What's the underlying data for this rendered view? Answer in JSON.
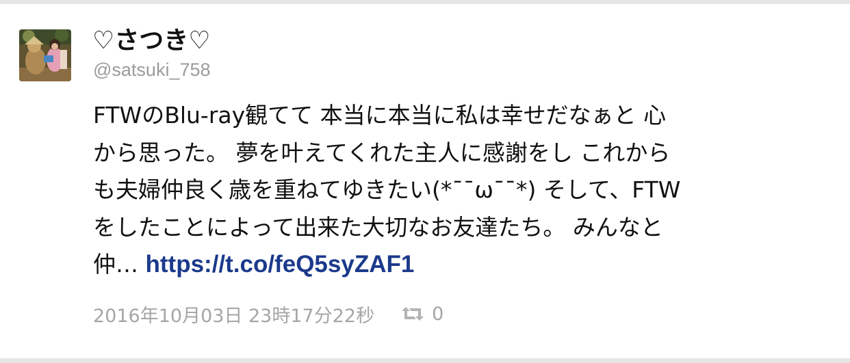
{
  "tweet": {
    "display_name": "♡さつき♡",
    "handle": "@satsuki_758",
    "text_lines": [
      "FTWのBlu-ray観てて 本当に本当に私は幸せだなぁと 心",
      "から思った。 夢を叶えてくれた主人に感謝をし これから",
      "も夫婦仲良く歳を重ねてゆきたい(*¯¯ω¯¯*) そして、FTW",
      "をしたことによって出来た大切なお友達たち。 みんなと"
    ],
    "last_line_prefix": "仲… ",
    "link": "https://t.co/feQ5syZAF1",
    "timestamp": "2016年10月03日 23時17分22秒",
    "retweet_count": "0"
  },
  "icons": {
    "avatar": "user-avatar-photo",
    "retweet": "retweet-icon"
  },
  "colors": {
    "link": "#1b3a8c",
    "meta_text": "#a5a5a5",
    "handle": "#9b9b9b",
    "border": "#e6e6e6"
  }
}
